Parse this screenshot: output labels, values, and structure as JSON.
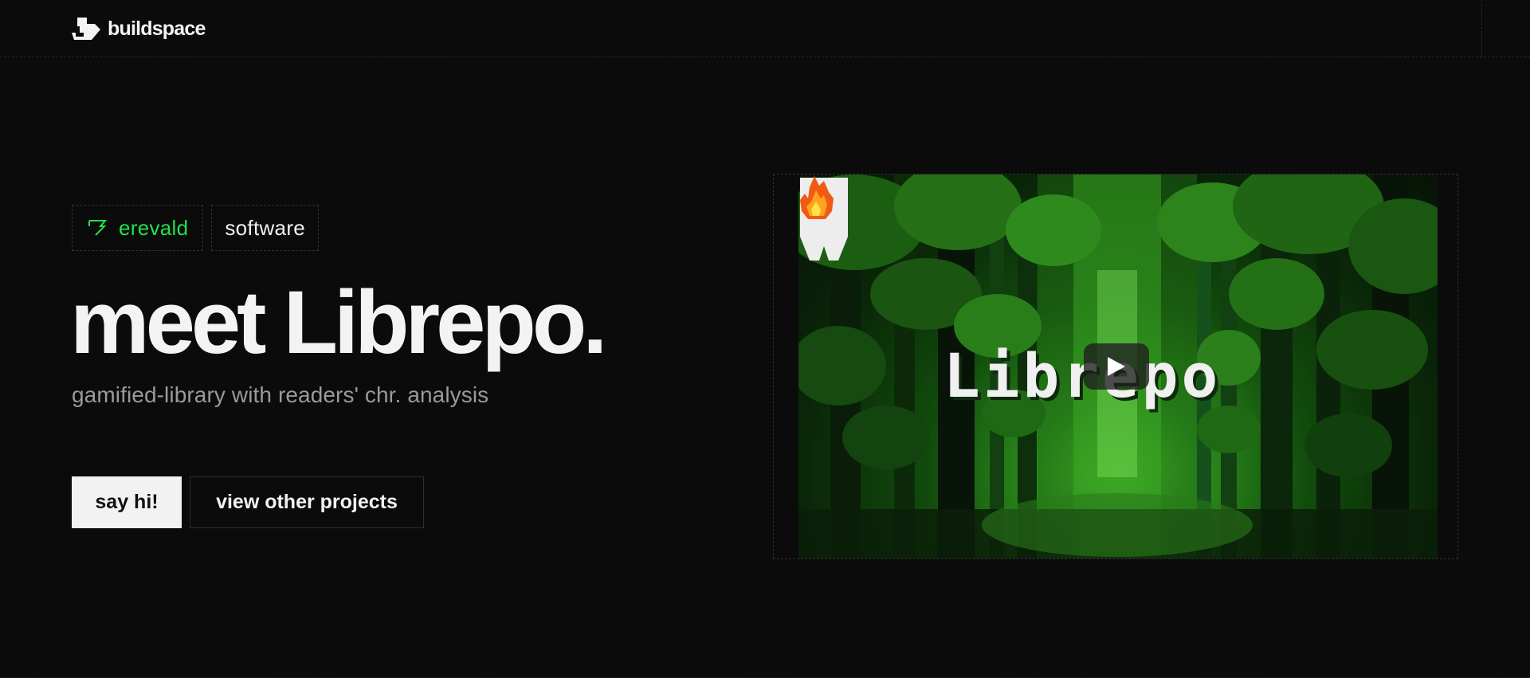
{
  "header": {
    "brand_name": "buildspace",
    "logo_icon": "buildspace-logo-icon"
  },
  "project": {
    "author_tag": {
      "icon": "flag-icon",
      "label": "erevald",
      "color": "#22e04a"
    },
    "category_tag": "software",
    "headline": "meet Librepo.",
    "subtitle": "gamified-library with readers' chr. analysis"
  },
  "actions": {
    "primary_label": "say hi!",
    "secondary_label": "view other projects"
  },
  "video": {
    "title_text": "Librepo",
    "play_icon": "play-icon",
    "shield_icon": "shield-logo-icon",
    "corner_icon": "fire-icon"
  },
  "colors": {
    "background": "#0b0b0b",
    "accent_green": "#22e04a",
    "button_light": "#f2f2f2"
  }
}
